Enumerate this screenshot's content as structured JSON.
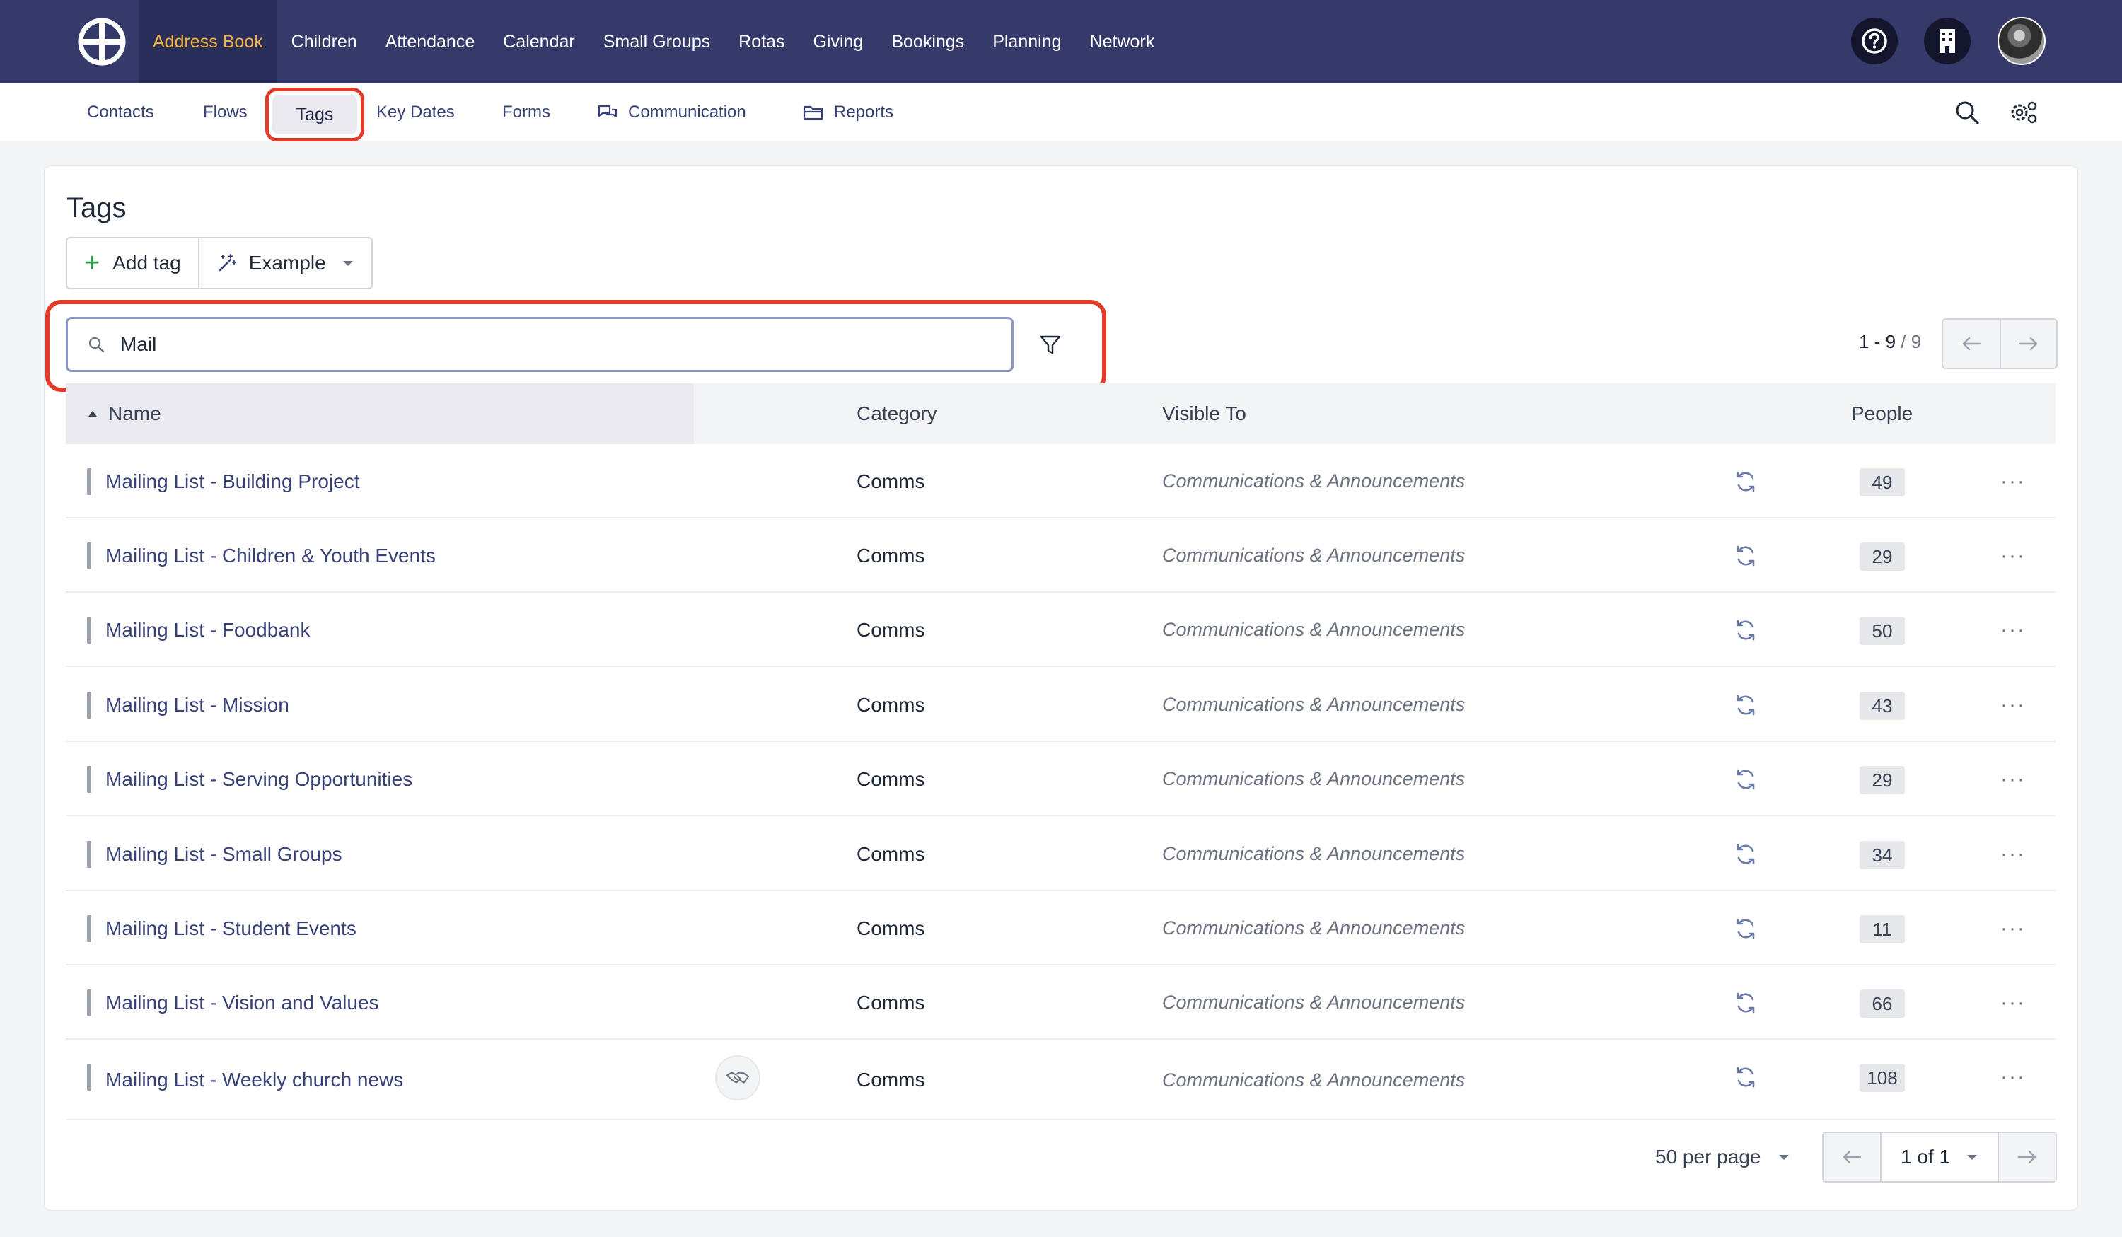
{
  "topnav": {
    "items": [
      {
        "label": "Address Book",
        "active": true
      },
      {
        "label": "Children"
      },
      {
        "label": "Attendance"
      },
      {
        "label": "Calendar"
      },
      {
        "label": "Small Groups"
      },
      {
        "label": "Rotas"
      },
      {
        "label": "Giving"
      },
      {
        "label": "Bookings"
      },
      {
        "label": "Planning"
      },
      {
        "label": "Network"
      }
    ],
    "icons": [
      "help-icon",
      "building-icon",
      "avatar"
    ]
  },
  "subnav": {
    "items": [
      {
        "label": "Contacts"
      },
      {
        "label": "Flows"
      },
      {
        "label": "Tags",
        "active": true
      },
      {
        "label": "Key Dates"
      },
      {
        "label": "Forms"
      },
      {
        "label": "Communication",
        "icon": "chat-icon"
      },
      {
        "label": "Reports",
        "icon": "folder-icon"
      }
    ],
    "icons": [
      "search-icon",
      "settings-icon"
    ]
  },
  "page": {
    "title": "Tags",
    "add_tag_label": "Add tag",
    "example_label": "Example",
    "search_value": "Mail",
    "pager_range": "1 - 9",
    "pager_total": "/ 9"
  },
  "table": {
    "headers": {
      "name": "Name",
      "category": "Category",
      "visible_to": "Visible To",
      "people": "People"
    },
    "rows": [
      {
        "name": "Mailing List - Building Project",
        "category": "Comms",
        "visible_to": "Communications & Announcements",
        "people": "49"
      },
      {
        "name": "Mailing List - Children & Youth Events",
        "category": "Comms",
        "visible_to": "Communications & Announcements",
        "people": "29"
      },
      {
        "name": "Mailing List - Foodbank",
        "category": "Comms",
        "visible_to": "Communications & Announcements",
        "people": "50"
      },
      {
        "name": "Mailing List - Mission",
        "category": "Comms",
        "visible_to": "Communications & Announcements",
        "people": "43"
      },
      {
        "name": "Mailing List - Serving Opportunities",
        "category": "Comms",
        "visible_to": "Communications & Announcements",
        "people": "29"
      },
      {
        "name": "Mailing List - Small Groups",
        "category": "Comms",
        "visible_to": "Communications & Announcements",
        "people": "34"
      },
      {
        "name": "Mailing List - Student Events",
        "category": "Comms",
        "visible_to": "Communications & Announcements",
        "people": "11"
      },
      {
        "name": "Mailing List - Vision and Values",
        "category": "Comms",
        "visible_to": "Communications & Announcements",
        "people": "66"
      },
      {
        "name": "Mailing List - Weekly church news",
        "category": "Comms",
        "visible_to": "Communications & Announcements",
        "people": "108"
      }
    ]
  },
  "footer": {
    "per_page": "50 per page",
    "page_of": "1 of 1"
  },
  "colors": {
    "nav_bg": "#353a6b",
    "active_nav_text": "#f5b53d",
    "link": "#384177",
    "highlight": "#e23b2a"
  }
}
